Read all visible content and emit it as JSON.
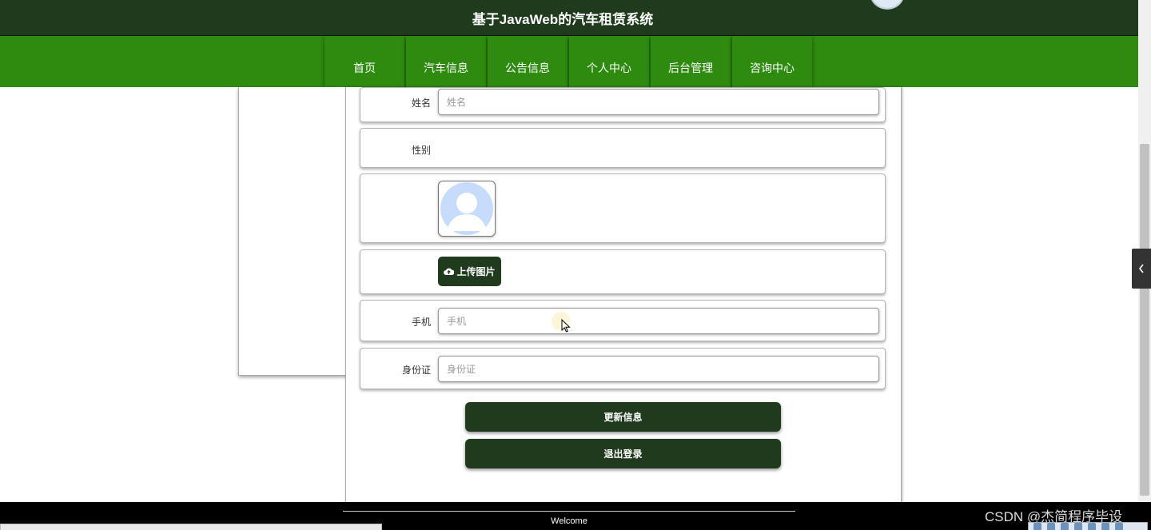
{
  "header": {
    "title": "基于JavaWeb的汽车租赁系统"
  },
  "nav": {
    "items": [
      {
        "label": "首页"
      },
      {
        "label": "汽车信息"
      },
      {
        "label": "公告信息"
      },
      {
        "label": "个人中心"
      },
      {
        "label": "后台管理"
      },
      {
        "label": "咨询中心"
      }
    ]
  },
  "form": {
    "name": {
      "label": "姓名",
      "placeholder": "姓名",
      "value": ""
    },
    "gender": {
      "label": "性别"
    },
    "upload": {
      "label": "上传图片"
    },
    "phone": {
      "label": "手机",
      "placeholder": "手机",
      "value": ""
    },
    "idcard": {
      "label": "身份证",
      "placeholder": "身份证",
      "value": ""
    },
    "update_button": "更新信息",
    "logout_button": "退出登录"
  },
  "footer": {
    "text": "Welcome"
  },
  "watermark": "CSDN @杰简程序毕设",
  "colors": {
    "header_dark": "#1f3a1c",
    "nav_green": "#2e8b10",
    "button_dark": "#1f3a1c"
  }
}
